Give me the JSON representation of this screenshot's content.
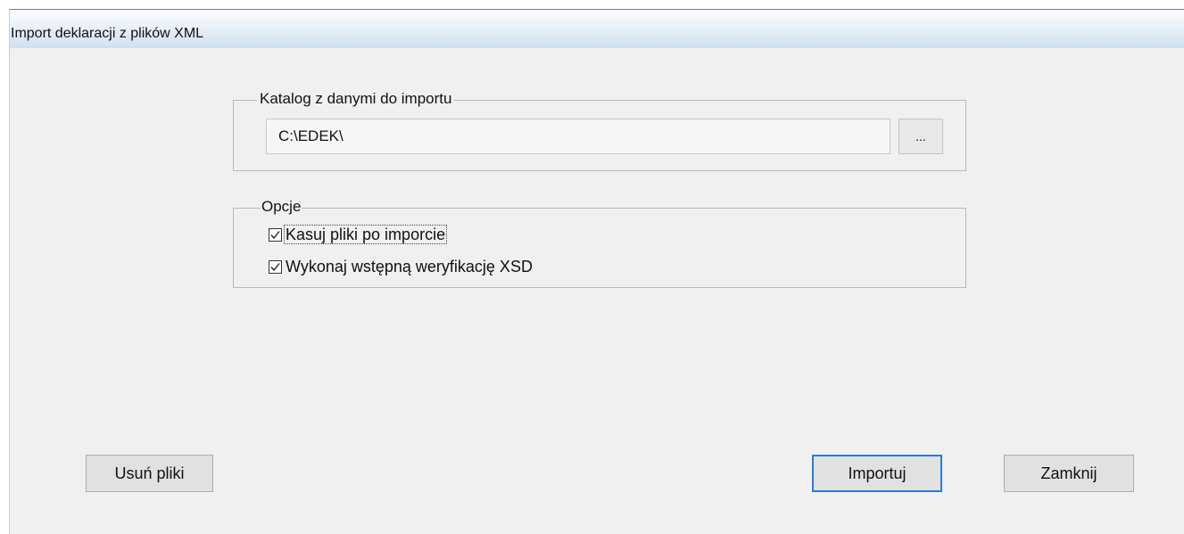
{
  "window": {
    "title": "Import deklaracji z plików XML"
  },
  "directory_group": {
    "legend": "Katalog z danymi do importu",
    "path_value": "C:\\EDEK\\",
    "browse_label": "..."
  },
  "options_group": {
    "legend": "Opcje",
    "options": [
      {
        "label": "Kasuj pliki po imporcie",
        "checked": true,
        "focused": true
      },
      {
        "label": "Wykonaj wstępną weryfikację XSD",
        "checked": true,
        "focused": false
      }
    ]
  },
  "buttons": {
    "delete_files": "Usuń pliki",
    "import": "Importuj",
    "close": "Zamknij"
  }
}
